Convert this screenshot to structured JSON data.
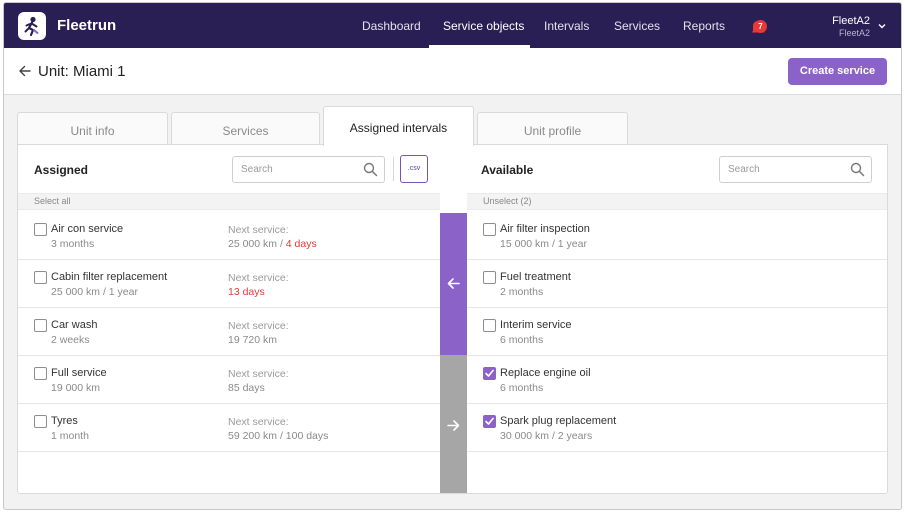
{
  "app": {
    "brand": "Fleetrun"
  },
  "nav": {
    "items": [
      {
        "label": "Dashboard"
      },
      {
        "label": "Service objects"
      },
      {
        "label": "Intervals"
      },
      {
        "label": "Services"
      },
      {
        "label": "Reports"
      }
    ],
    "active_index": 1,
    "notifications_count": "7",
    "user_name": "FleetA2",
    "user_account": "FleetA2"
  },
  "header": {
    "title": "Unit: Miami 1",
    "create_button": "Create service"
  },
  "tabs": [
    {
      "label": "Unit info"
    },
    {
      "label": "Services"
    },
    {
      "label": "Assigned intervals"
    },
    {
      "label": "Unit profile"
    }
  ],
  "assigned": {
    "title": "Assigned",
    "search_placeholder": "Search",
    "csv_label": ".csv",
    "select_all": "Select all",
    "rows": [
      {
        "name": "Air con service",
        "interval": "3 months",
        "next_label": "Next service:",
        "next_value": "25 000 km / ",
        "next_overdue": "4 days"
      },
      {
        "name": "Cabin filter replacement",
        "interval": "25 000 km / 1 year",
        "next_label": "Next service:",
        "next_value": "",
        "next_overdue": "13 days"
      },
      {
        "name": "Car wash",
        "interval": "2 weeks",
        "next_label": "Next service:",
        "next_value": "19 720 km",
        "next_overdue": ""
      },
      {
        "name": "Full service",
        "interval": "19 000 km",
        "next_label": "Next service:",
        "next_value": "85 days",
        "next_overdue": ""
      },
      {
        "name": "Tyres",
        "interval": "1 month",
        "next_label": "Next service:",
        "next_value": "59 200 km / 100 days",
        "next_overdue": ""
      }
    ]
  },
  "available": {
    "title": "Available",
    "search_placeholder": "Search",
    "unselect": "Unselect (2)",
    "rows": [
      {
        "name": "Air filter inspection",
        "interval": "15 000 km / 1 year",
        "checked": false
      },
      {
        "name": "Fuel treatment",
        "interval": "2 months",
        "checked": false
      },
      {
        "name": "Interim service",
        "interval": "6 months",
        "checked": false
      },
      {
        "name": "Replace engine oil",
        "interval": "6 months",
        "checked": true
      },
      {
        "name": "Spark plug replacement",
        "interval": "30 000 km / 2 years",
        "checked": true
      }
    ]
  },
  "colors": {
    "nav_bg": "#2a1f55",
    "accent": "#8b63c8",
    "overdue": "#e53935",
    "move_right_bg": "#a6a6a6"
  },
  "icons": {
    "logo": "fleetrun-runner-logo-icon",
    "bell": "bell-icon",
    "back": "arrow-left-icon",
    "search": "search-icon",
    "move_left": "arrow-left-icon",
    "move_right": "arrow-right-icon",
    "user_menu": "chevron-down-icon"
  }
}
